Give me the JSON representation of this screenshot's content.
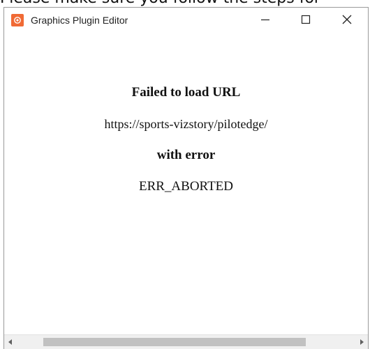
{
  "background_text": "Please make sure you follow the steps for",
  "window": {
    "title": "Graphics Plugin Editor",
    "app_icon": "graphics-plugin-app-icon",
    "accent_color": "#f06a35"
  },
  "controls": {
    "minimize_icon": "minimize-icon",
    "maximize_icon": "maximize-icon",
    "close_icon": "close-icon"
  },
  "message": {
    "title": "Failed to load URL",
    "url": "https://sports-vizstory/pilotedge/",
    "with_error": "with error",
    "error_code": "ERR_ABORTED"
  },
  "scrollbar": {
    "left_icon": "scroll-left-arrow-icon",
    "right_icon": "scroll-right-arrow-icon"
  }
}
